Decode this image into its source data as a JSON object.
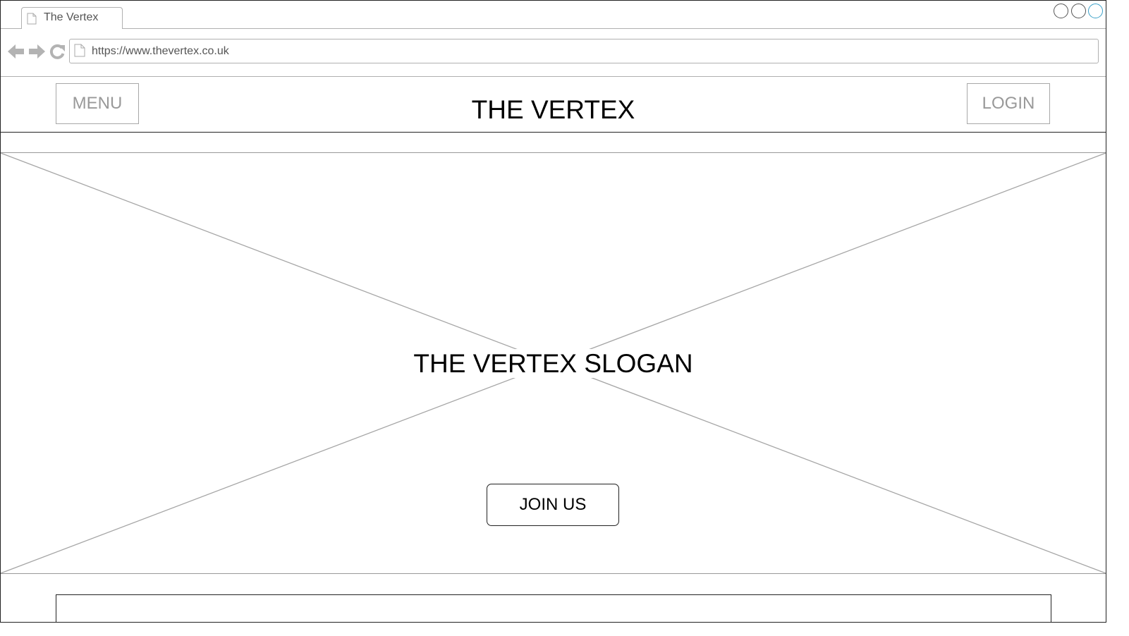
{
  "browser": {
    "tab_title": "The Vertex",
    "url": "https://www.thevertex.co.uk",
    "accent_color": "#3aa0c8"
  },
  "header": {
    "menu_label": "MENU",
    "site_title": "THE VERTEX",
    "login_label": "LOGIN"
  },
  "hero": {
    "slogan": "THE VERTEX SLOGAN",
    "cta_label": "JOIN US"
  }
}
